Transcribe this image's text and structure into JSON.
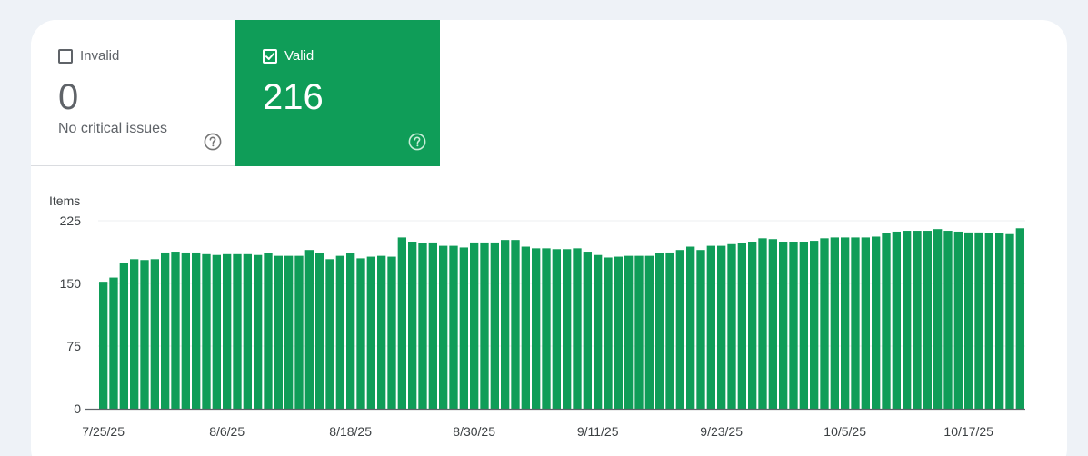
{
  "tiles": {
    "invalid": {
      "label": "Invalid",
      "count": "0",
      "description": "No critical issues",
      "checked": false,
      "help_icon": "question-circle-icon"
    },
    "valid": {
      "label": "Valid",
      "count": "216",
      "checked": true,
      "help_icon": "question-circle-icon"
    }
  },
  "colors": {
    "valid_green": "#0f9d58",
    "bar_green": "#0f9d58",
    "grid": "#eceff1",
    "axis": "#5f6368"
  },
  "chart_data": {
    "type": "bar",
    "ylabel": "Items",
    "ylim": [
      0,
      225
    ],
    "yticks": [
      0,
      75,
      150,
      225
    ],
    "xtick_labels": [
      "7/25/25",
      "8/6/25",
      "8/18/25",
      "8/30/25",
      "9/11/25",
      "9/23/25",
      "10/5/25",
      "10/17/25"
    ],
    "grid": true,
    "series": [
      {
        "values": [
          152,
          157,
          175,
          179,
          178,
          179,
          187,
          188,
          187,
          187,
          185,
          184,
          185,
          185,
          185,
          184,
          186,
          183,
          183,
          183,
          190,
          186,
          179,
          183,
          186,
          180,
          182,
          183,
          182,
          205,
          200,
          198,
          199,
          195,
          195,
          193,
          199,
          199,
          199,
          202,
          202,
          194,
          192,
          192,
          191,
          191,
          192,
          188,
          184,
          181,
          182,
          183,
          183,
          183,
          186,
          187,
          190,
          194,
          190,
          195,
          195,
          197,
          198,
          200,
          204,
          203,
          200,
          200,
          200,
          201,
          204,
          205,
          205,
          205,
          205,
          206,
          210,
          212,
          213,
          213,
          213,
          215,
          213,
          212,
          211,
          211,
          210,
          210,
          209,
          216
        ]
      }
    ]
  }
}
